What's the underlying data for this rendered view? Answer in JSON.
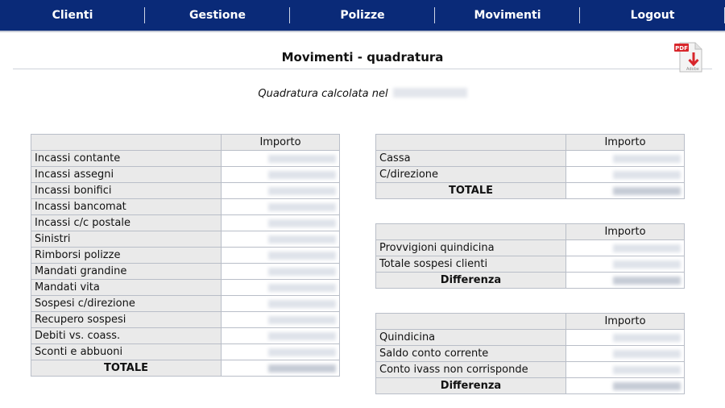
{
  "nav": [
    "Clienti",
    "Gestione",
    "Polizze",
    "Movimenti",
    "Logout"
  ],
  "page": {
    "title": "Movimenti - quadratura",
    "subtitle": "Quadratura calcolata nel",
    "pdf_icon": "pdf-export-icon",
    "pdf_label": "PDF",
    "pdf_sub": "Adobe"
  },
  "colors": {
    "navbar": "#0a2a78",
    "header_cell": "#eaeaea",
    "border": "#b9bec8",
    "pdf": "#d8262b"
  },
  "tables": {
    "incassi": {
      "header": "Importo",
      "rows": [
        "Incassi contante",
        "Incassi assegni",
        "Incassi bonifici",
        "Incassi bancomat",
        "Incassi c/c postale",
        "Sinistri",
        "Rimborsi polizze",
        "Mandati grandine",
        "Mandati vita",
        "Sospesi c/direzione",
        "Recupero sospesi",
        "Debiti vs. coass.",
        "Sconti e abbuoni"
      ],
      "total": "TOTALE"
    },
    "cassa": {
      "header": "Importo",
      "rows": [
        "Cassa",
        "C/direzione"
      ],
      "total": "TOTALE"
    },
    "provvigioni": {
      "header": "Importo",
      "rows": [
        "Provvigioni quindicina",
        "Totale sospesi clienti"
      ],
      "total": "Differenza"
    },
    "quindicina": {
      "header": "Importo",
      "rows": [
        "Quindicina",
        "Saldo conto corrente",
        "Conto ivass non corrisponde"
      ],
      "total": "Differenza"
    }
  }
}
